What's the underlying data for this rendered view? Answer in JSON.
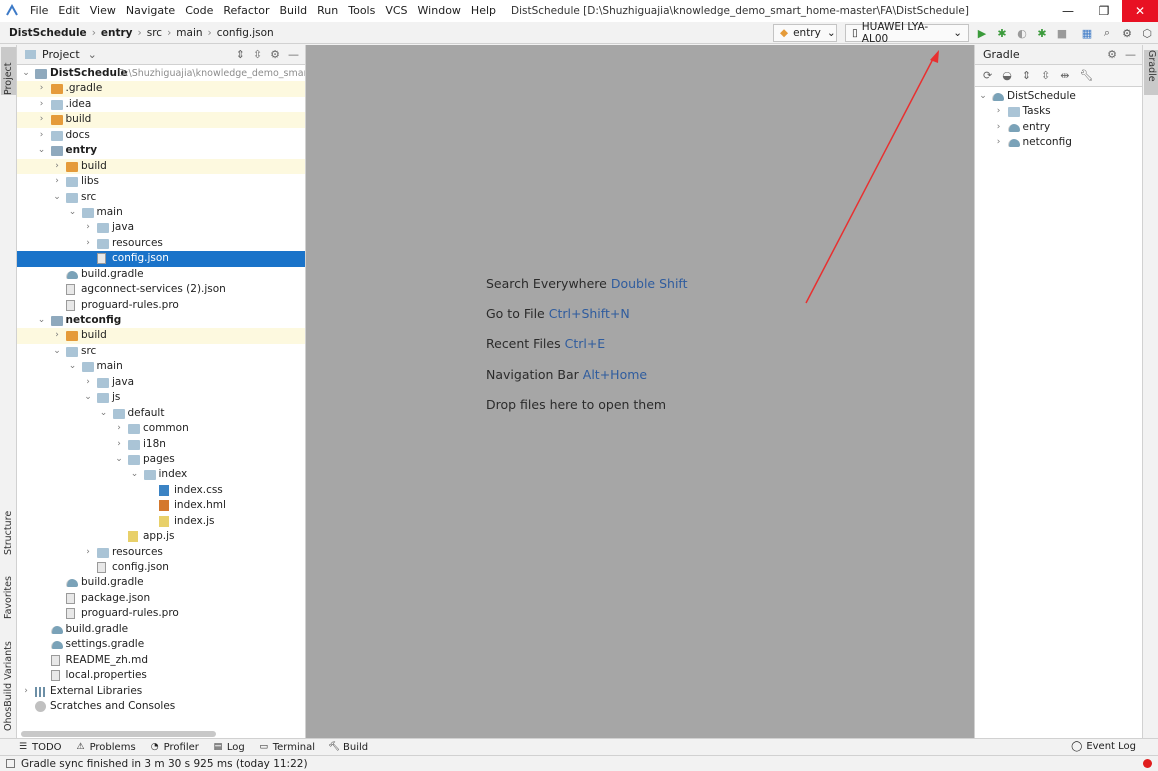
{
  "colors": {
    "accent": "#1a73c9",
    "close_button": "#e81123",
    "run_green": "#3a9a3a",
    "annotation_arrow": "#e83030",
    "error_dot": "#e01e1e"
  },
  "menu": [
    "File",
    "Edit",
    "View",
    "Navigate",
    "Code",
    "Refactor",
    "Build",
    "Run",
    "Tools",
    "VCS",
    "Window",
    "Help"
  ],
  "window_title": "DistSchedule [D:\\Shuzhiguajia\\knowledge_demo_smart_home-master\\FA\\DistSchedule]",
  "breadcrumb": [
    "DistSchedule",
    "entry",
    "src",
    "main",
    "config.json"
  ],
  "run_config": "entry",
  "device": "HUAWEI LYA-AL00",
  "project_panel": {
    "title": "Project"
  },
  "tree": [
    {
      "label": "DistSchedule",
      "extra": "D:\\Shuzhiguajia\\knowledge_demo_smart_ho",
      "level": 0,
      "arrow": "open",
      "icon": "folder-mod",
      "bold": true
    },
    {
      "label": ".gradle",
      "level": 1,
      "arrow": "closed",
      "icon": "folder-orange",
      "hl": "yellow"
    },
    {
      "label": ".idea",
      "level": 1,
      "arrow": "closed",
      "icon": "folder"
    },
    {
      "label": "build",
      "level": 1,
      "arrow": "closed",
      "icon": "folder-orange",
      "hl": "yellow"
    },
    {
      "label": "docs",
      "level": 1,
      "arrow": "closed",
      "icon": "folder"
    },
    {
      "label": "entry",
      "level": 1,
      "arrow": "open",
      "icon": "folder-mod",
      "bold": true
    },
    {
      "label": "build",
      "level": 2,
      "arrow": "closed",
      "icon": "folder-orange",
      "hl": "yellow"
    },
    {
      "label": "libs",
      "level": 2,
      "arrow": "closed",
      "icon": "folder"
    },
    {
      "label": "src",
      "level": 2,
      "arrow": "open",
      "icon": "folder"
    },
    {
      "label": "main",
      "level": 3,
      "arrow": "open",
      "icon": "folder"
    },
    {
      "label": "java",
      "level": 4,
      "arrow": "closed",
      "icon": "folder"
    },
    {
      "label": "resources",
      "level": 4,
      "arrow": "closed",
      "icon": "folder"
    },
    {
      "label": "config.json",
      "level": 4,
      "arrow": "none",
      "icon": "file",
      "hl": "selected"
    },
    {
      "label": "build.gradle",
      "level": 2,
      "arrow": "none",
      "icon": "gradle"
    },
    {
      "label": "agconnect-services (2).json",
      "level": 2,
      "arrow": "none",
      "icon": "file"
    },
    {
      "label": "proguard-rules.pro",
      "level": 2,
      "arrow": "none",
      "icon": "file"
    },
    {
      "label": "netconfig",
      "level": 1,
      "arrow": "open",
      "icon": "folder-mod",
      "bold": true
    },
    {
      "label": "build",
      "level": 2,
      "arrow": "closed",
      "icon": "folder-orange",
      "hl": "yellow"
    },
    {
      "label": "src",
      "level": 2,
      "arrow": "open",
      "icon": "folder"
    },
    {
      "label": "main",
      "level": 3,
      "arrow": "open",
      "icon": "folder"
    },
    {
      "label": "java",
      "level": 4,
      "arrow": "closed",
      "icon": "folder"
    },
    {
      "label": "js",
      "level": 4,
      "arrow": "open",
      "icon": "folder"
    },
    {
      "label": "default",
      "level": 5,
      "arrow": "open",
      "icon": "folder"
    },
    {
      "label": "common",
      "level": 6,
      "arrow": "closed",
      "icon": "folder"
    },
    {
      "label": "i18n",
      "level": 6,
      "arrow": "closed",
      "icon": "folder"
    },
    {
      "label": "pages",
      "level": 6,
      "arrow": "open",
      "icon": "folder"
    },
    {
      "label": "index",
      "level": 7,
      "arrow": "open",
      "icon": "folder"
    },
    {
      "label": "index.css",
      "level": 8,
      "arrow": "none",
      "icon": "css"
    },
    {
      "label": "index.hml",
      "level": 8,
      "arrow": "none",
      "icon": "html"
    },
    {
      "label": "index.js",
      "level": 8,
      "arrow": "none",
      "icon": "js"
    },
    {
      "label": "app.js",
      "level": 6,
      "arrow": "none",
      "icon": "js"
    },
    {
      "label": "resources",
      "level": 4,
      "arrow": "closed",
      "icon": "folder"
    },
    {
      "label": "config.json",
      "level": 4,
      "arrow": "none",
      "icon": "file"
    },
    {
      "label": "build.gradle",
      "level": 2,
      "arrow": "none",
      "icon": "gradle"
    },
    {
      "label": "package.json",
      "level": 2,
      "arrow": "none",
      "icon": "file"
    },
    {
      "label": "proguard-rules.pro",
      "level": 2,
      "arrow": "none",
      "icon": "file"
    },
    {
      "label": "build.gradle",
      "level": 1,
      "arrow": "none",
      "icon": "gradle"
    },
    {
      "label": "settings.gradle",
      "level": 1,
      "arrow": "none",
      "icon": "gradle"
    },
    {
      "label": "README_zh.md",
      "level": 1,
      "arrow": "none",
      "icon": "file"
    },
    {
      "label": "local.properties",
      "level": 1,
      "arrow": "none",
      "icon": "file"
    },
    {
      "label": "External Libraries",
      "level": 0,
      "arrow": "closed",
      "icon": "lib"
    },
    {
      "label": "Scratches and Consoles",
      "level": 0,
      "arrow": "none",
      "icon": "scratch"
    }
  ],
  "editor_hints": [
    {
      "text": "Search Everywhere",
      "key": "Double Shift"
    },
    {
      "text": "Go to File",
      "key": "Ctrl+Shift+N"
    },
    {
      "text": "Recent Files",
      "key": "Ctrl+E"
    },
    {
      "text": "Navigation Bar",
      "key": "Alt+Home"
    },
    {
      "text": "Drop files here to open them",
      "key": ""
    }
  ],
  "gradle_panel": {
    "title": "Gradle",
    "tree": [
      {
        "label": "DistSchedule",
        "level": 0,
        "arrow": "open"
      },
      {
        "label": "Tasks",
        "level": 1,
        "arrow": "closed"
      },
      {
        "label": "entry",
        "level": 1,
        "arrow": "closed"
      },
      {
        "label": "netconfig",
        "level": 1,
        "arrow": "closed"
      }
    ]
  },
  "left_tabs": [
    "Project",
    "Structure",
    "Favorites",
    "OhosBuild Variants"
  ],
  "right_tabs": [
    "Gradle"
  ],
  "bottom_tabs": [
    "TODO",
    "Problems",
    "Profiler",
    "Log",
    "Terminal",
    "Build"
  ],
  "event_log": "Event Log",
  "status": "Gradle sync finished in 3 m 30 s 925 ms (today 11:22)"
}
